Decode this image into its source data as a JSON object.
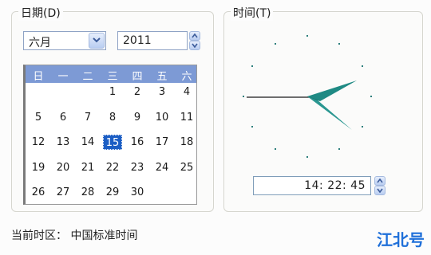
{
  "date_group": {
    "title": "日期(D)",
    "month": "六月",
    "year": "2011",
    "weekdays": [
      "日",
      "一",
      "二",
      "三",
      "四",
      "五",
      "六"
    ],
    "weeks": [
      [
        "",
        "",
        "",
        "1",
        "2",
        "3",
        "4"
      ],
      [
        "5",
        "6",
        "7",
        "8",
        "9",
        "10",
        "11"
      ],
      [
        "12",
        "13",
        "14",
        "15",
        "16",
        "17",
        "18"
      ],
      [
        "19",
        "20",
        "21",
        "22",
        "23",
        "24",
        "25"
      ],
      [
        "26",
        "27",
        "28",
        "29",
        "30",
        "",
        ""
      ]
    ],
    "selected_day": "15"
  },
  "time_group": {
    "title": "时间(T)",
    "time": "14: 22: 45"
  },
  "timezone_label": "当前时区： 中国标准时间",
  "watermark": "江北号",
  "colors": {
    "calendar_header": "#7d9ad5",
    "selected_day": "#1c5ec4",
    "clock_hands": "#1f8a84"
  },
  "icons": {
    "month_dropdown": "chevron-down-icon",
    "year_spinner": "spinner-icon",
    "time_spinner": "spinner-icon"
  }
}
